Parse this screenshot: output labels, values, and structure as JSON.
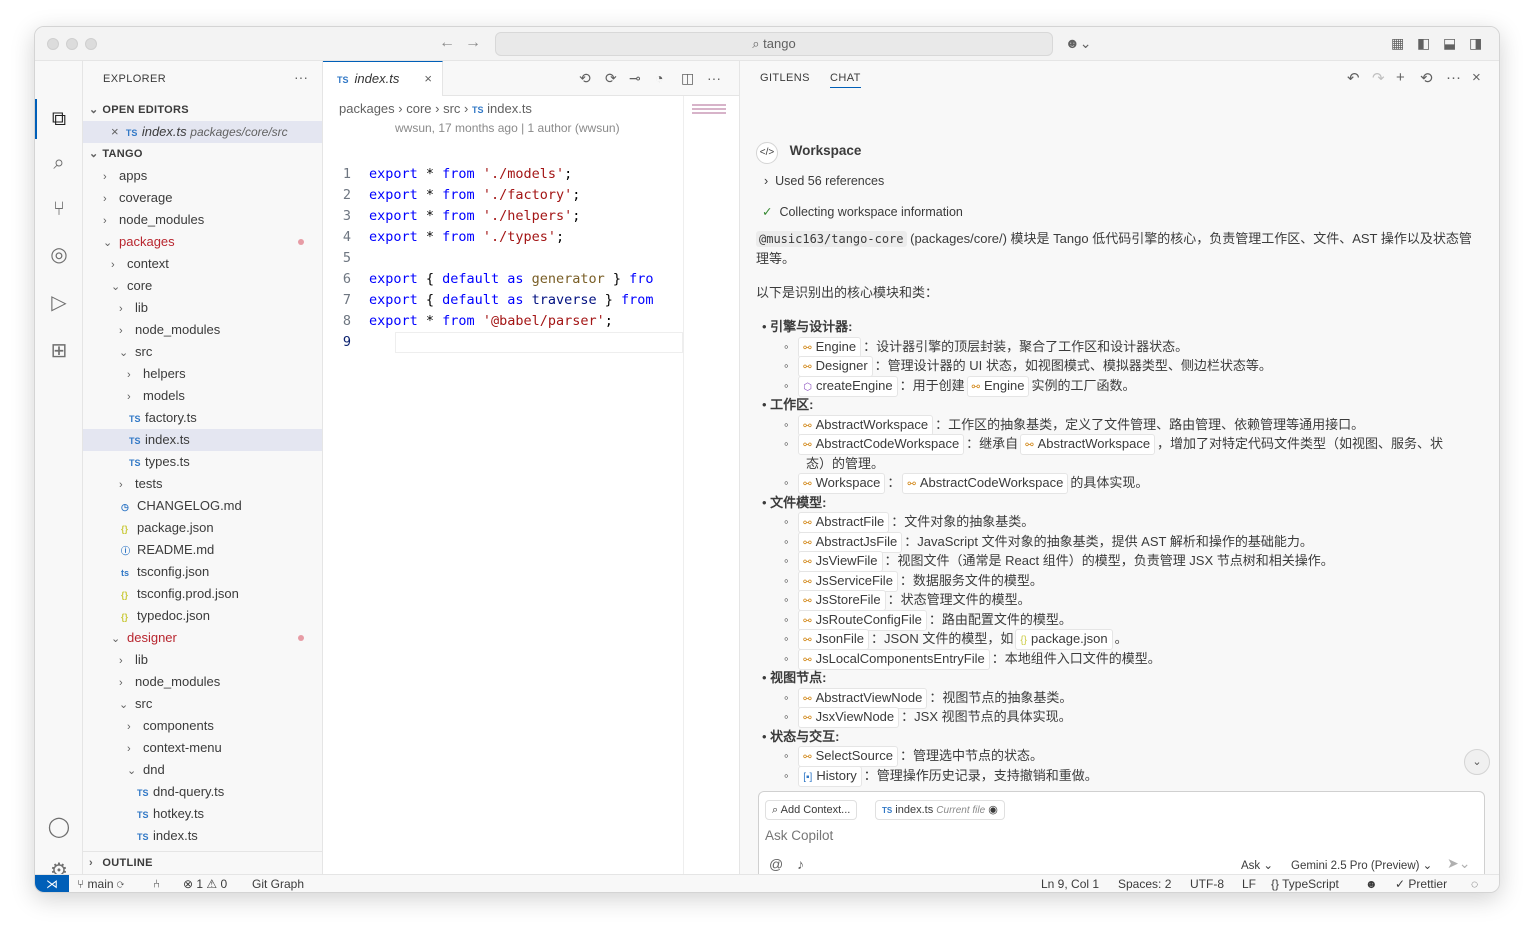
{
  "titlebar": {
    "search": "tango"
  },
  "sidebar": {
    "title": "EXPLORER",
    "open_editors_header": "OPEN EDITORS",
    "open_editor": {
      "name": "index.ts",
      "path": "packages/core/src"
    },
    "root_header": "TANGO",
    "outline_header": "OUTLINE",
    "tree": [
      {
        "label": "apps",
        "type": "folder",
        "depth": 0,
        "open": false
      },
      {
        "label": "coverage",
        "type": "folder",
        "depth": 0,
        "open": false
      },
      {
        "label": "node_modules",
        "type": "folder",
        "depth": 0,
        "open": false
      },
      {
        "label": "packages",
        "type": "folder",
        "depth": 0,
        "open": true,
        "modified": true
      },
      {
        "label": "context",
        "type": "folder",
        "depth": 1,
        "open": false
      },
      {
        "label": "core",
        "type": "folder",
        "depth": 1,
        "open": true
      },
      {
        "label": "lib",
        "type": "folder",
        "depth": 2,
        "open": false
      },
      {
        "label": "node_modules",
        "type": "folder",
        "depth": 2,
        "open": false
      },
      {
        "label": "src",
        "type": "folder",
        "depth": 2,
        "open": true
      },
      {
        "label": "helpers",
        "type": "folder",
        "depth": 3,
        "open": false
      },
      {
        "label": "models",
        "type": "folder",
        "depth": 3,
        "open": false
      },
      {
        "label": "factory.ts",
        "type": "ts",
        "depth": 3
      },
      {
        "label": "index.ts",
        "type": "ts",
        "depth": 3,
        "selected": true
      },
      {
        "label": "types.ts",
        "type": "ts",
        "depth": 3
      },
      {
        "label": "tests",
        "type": "folder",
        "depth": 2,
        "open": false
      },
      {
        "label": "CHANGELOG.md",
        "type": "md",
        "depth": 2
      },
      {
        "label": "package.json",
        "type": "json",
        "depth": 2
      },
      {
        "label": "README.md",
        "type": "info",
        "depth": 2
      },
      {
        "label": "tsconfig.json",
        "type": "tsconfig",
        "depth": 2
      },
      {
        "label": "tsconfig.prod.json",
        "type": "json",
        "depth": 2
      },
      {
        "label": "typedoc.json",
        "type": "json",
        "depth": 2
      },
      {
        "label": "designer",
        "type": "folder",
        "depth": 1,
        "open": true,
        "modified": true
      },
      {
        "label": "lib",
        "type": "folder",
        "depth": 2,
        "open": false
      },
      {
        "label": "node_modules",
        "type": "folder",
        "depth": 2,
        "open": false
      },
      {
        "label": "src",
        "type": "folder",
        "depth": 2,
        "open": true
      },
      {
        "label": "components",
        "type": "folder",
        "depth": 3,
        "open": false
      },
      {
        "label": "context-menu",
        "type": "folder",
        "depth": 3,
        "open": false
      },
      {
        "label": "dnd",
        "type": "folder",
        "depth": 3,
        "open": true
      },
      {
        "label": "dnd-query.ts",
        "type": "ts",
        "depth": 4
      },
      {
        "label": "hotkey.ts",
        "type": "ts",
        "depth": 4
      },
      {
        "label": "index.ts",
        "type": "ts",
        "depth": 4
      }
    ]
  },
  "editor": {
    "tab_label": "index.ts",
    "breadcrumb": [
      "packages",
      "core",
      "src",
      "index.ts"
    ],
    "blame": "wwsun, 17 months ago | 1 author (wwsun)",
    "lines": [
      [
        {
          "t": "export",
          "c": "kw"
        },
        {
          "t": " * ",
          "c": "op"
        },
        {
          "t": "from",
          "c": "kw"
        },
        {
          "t": " './models'",
          "c": "str"
        },
        {
          "t": ";",
          "c": "op"
        }
      ],
      [
        {
          "t": "export",
          "c": "kw"
        },
        {
          "t": " * ",
          "c": "op"
        },
        {
          "t": "from",
          "c": "kw"
        },
        {
          "t": " './factory'",
          "c": "str"
        },
        {
          "t": ";",
          "c": "op"
        }
      ],
      [
        {
          "t": "export",
          "c": "kw"
        },
        {
          "t": " * ",
          "c": "op"
        },
        {
          "t": "from",
          "c": "kw"
        },
        {
          "t": " './helpers'",
          "c": "str"
        },
        {
          "t": ";",
          "c": "op"
        }
      ],
      [
        {
          "t": "export",
          "c": "kw"
        },
        {
          "t": " * ",
          "c": "op"
        },
        {
          "t": "from",
          "c": "kw"
        },
        {
          "t": " './types'",
          "c": "str"
        },
        {
          "t": ";",
          "c": "op"
        }
      ],
      [],
      [
        {
          "t": "export",
          "c": "kw"
        },
        {
          "t": " { ",
          "c": "op"
        },
        {
          "t": "default",
          "c": "kw"
        },
        {
          "t": " as ",
          "c": "kw"
        },
        {
          "t": "generator",
          "c": "fn"
        },
        {
          "t": " } ",
          "c": "op"
        },
        {
          "t": "fro",
          "c": "kw"
        }
      ],
      [
        {
          "t": "export",
          "c": "kw"
        },
        {
          "t": " { ",
          "c": "op"
        },
        {
          "t": "default",
          "c": "kw"
        },
        {
          "t": " as ",
          "c": "kw"
        },
        {
          "t": "traverse",
          "c": "id"
        },
        {
          "t": " } ",
          "c": "op"
        },
        {
          "t": "from",
          "c": "kw"
        }
      ],
      [
        {
          "t": "export",
          "c": "kw"
        },
        {
          "t": " * ",
          "c": "op"
        },
        {
          "t": "from",
          "c": "kw"
        },
        {
          "t": " '@babel/parser'",
          "c": "str"
        },
        {
          "t": ";",
          "c": "op"
        }
      ],
      []
    ]
  },
  "chat": {
    "tabs": [
      "GITLENS",
      "CHAT"
    ],
    "workspace_label": "Workspace",
    "references": "Used 56 references",
    "collecting": "Collecting workspace information",
    "intro_code": "@music163/tango-core",
    "intro_text_1": "(packages/core/) 模块是 Tango 低代码引擎的核心，负责管理工作区、文件、AST 操作以及状态管",
    "intro_text_2": "理等。",
    "lead": "以下是识别出的核心模块和类：",
    "sections": [
      {
        "title": "引擎与设计器:",
        "items": [
          {
            "parts": [
              {
                "chip": "Engine"
              },
              {
                "text": "：设计器引擎的顶层封装，聚合了工作区和设计器状态。"
              }
            ]
          },
          {
            "parts": [
              {
                "chip": "Designer"
              },
              {
                "text": "：管理设计器的 UI 状态，如视图模式、模拟器类型、侧边栏状态等。"
              }
            ]
          },
          {
            "parts": [
              {
                "chip": "createEngine",
                "icon": "cube"
              },
              {
                "text": "：用于创建"
              },
              {
                "chip": "Engine"
              },
              {
                "text": "实例的工厂函数。"
              }
            ]
          }
        ]
      },
      {
        "title": "工作区:",
        "items": [
          {
            "parts": [
              {
                "chip": "AbstractWorkspace"
              },
              {
                "text": "：工作区的抽象基类，定义了文件管理、路由管理、依赖管理等通用接口。"
              }
            ]
          },
          {
            "parts": [
              {
                "chip": "AbstractCodeWorkspace"
              },
              {
                "text": "：继承自"
              },
              {
                "chip": "AbstractWorkspace"
              },
              {
                "text": "，增加了对特定代码文件类型（如视图、服务、状"
              }
            ],
            "cont": "态）的管理。"
          },
          {
            "parts": [
              {
                "chip": "Workspace"
              },
              {
                "text": "："
              },
              {
                "chip": "AbstractCodeWorkspace"
              },
              {
                "text": "的具体实现。"
              }
            ]
          }
        ]
      },
      {
        "title": "文件模型:",
        "items": [
          {
            "parts": [
              {
                "chip": "AbstractFile"
              },
              {
                "text": "：文件对象的抽象基类。"
              }
            ]
          },
          {
            "parts": [
              {
                "chip": "AbstractJsFile"
              },
              {
                "text": "：JavaScript 文件对象的抽象基类，提供 AST 解析和操作的基础能力。"
              }
            ]
          },
          {
            "parts": [
              {
                "chip": "JsViewFile"
              },
              {
                "text": "：视图文件（通常是 React 组件）的模型，负责管理 JSX 节点树和相关操作。"
              }
            ]
          },
          {
            "parts": [
              {
                "chip": "JsServiceFile"
              },
              {
                "text": "：数据服务文件的模型。"
              }
            ]
          },
          {
            "parts": [
              {
                "chip": "JsStoreFile"
              },
              {
                "text": "：状态管理文件的模型。"
              }
            ]
          },
          {
            "parts": [
              {
                "chip": "JsRouteConfigFile"
              },
              {
                "text": "：路由配置文件的模型。"
              }
            ]
          },
          {
            "parts": [
              {
                "chip": "JsonFile"
              },
              {
                "text": "：JSON 文件的模型，如"
              },
              {
                "chip": "package.json",
                "icon": "json"
              },
              {
                "text": "。"
              }
            ]
          },
          {
            "parts": [
              {
                "chip": "JsLocalComponentsEntryFile"
              },
              {
                "text": "：本地组件入口文件的模型。"
              }
            ]
          }
        ]
      },
      {
        "title": "视图节点:",
        "items": [
          {
            "parts": [
              {
                "chip": "AbstractViewNode"
              },
              {
                "text": "：视图节点的抽象基类。"
              }
            ]
          },
          {
            "parts": [
              {
                "chip": "JsxViewNode"
              },
              {
                "text": "：JSX 视图节点的具体实现。"
              }
            ]
          }
        ]
      },
      {
        "title": "状态与交互:",
        "items": [
          {
            "parts": [
              {
                "chip": "SelectSource"
              },
              {
                "text": "：管理选中节点的状态。"
              }
            ]
          },
          {
            "parts": [
              {
                "chip": "History",
                "icon": "field"
              },
              {
                "text": "：管理操作历史记录，支持撤销和重做。"
              }
            ]
          }
        ]
      }
    ],
    "input": {
      "add_context": "Add Context...",
      "file_chip": "index.ts",
      "file_chip_note": "Current file",
      "placeholder": "Ask Copilot",
      "mode": "Ask",
      "model": "Gemini 2.5 Pro (Preview)"
    }
  },
  "statusbar": {
    "branch": "main",
    "errors": "1",
    "warnings": "0",
    "git_graph": "Git Graph",
    "position": "Ln 9, Col 1",
    "spaces": "Spaces: 2",
    "encoding": "UTF-8",
    "eol": "LF",
    "language": "TypeScript",
    "prettier": "Prettier"
  },
  "colors": {
    "accent": "#005fb8",
    "keyword": "#0000ff",
    "string": "#a31515",
    "modified": "#b8262f"
  }
}
